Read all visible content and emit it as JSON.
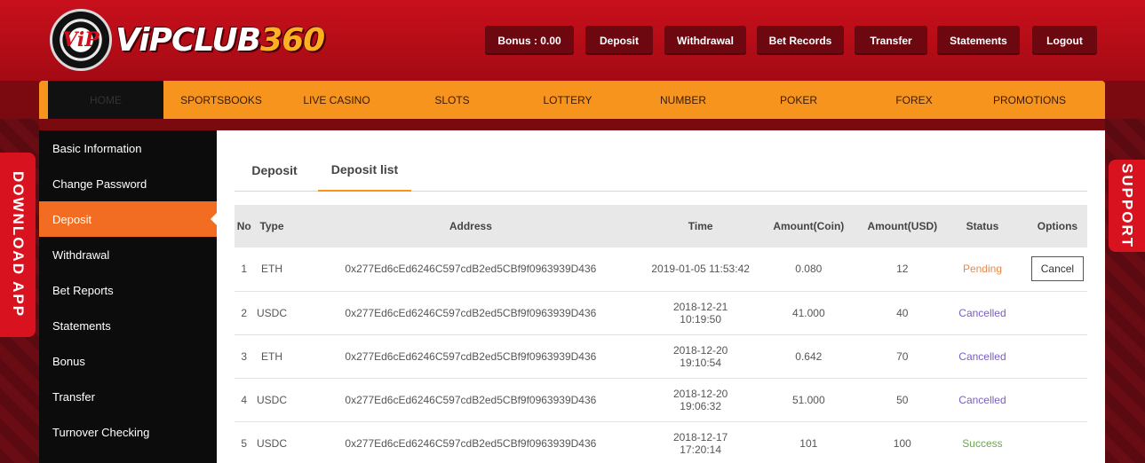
{
  "brand": {
    "logo_mark": "ViP",
    "name": "ViPCLUB",
    "name_num": "360"
  },
  "top_buttons": [
    "Bonus : 0.00",
    "Deposit",
    "Withdrawal",
    "Bet Records",
    "Transfer",
    "Statements",
    "Logout"
  ],
  "nav": [
    "HOME",
    "SPORTSBOOKS",
    "LIVE CASINO",
    "SLOTS",
    "LOTTERY",
    "NUMBER",
    "POKER",
    "FOREX",
    "PROMOTIONS"
  ],
  "side_tabs": {
    "download": "DOWNLOAD APP",
    "support": "SUPPORT"
  },
  "sidebar": [
    "Basic Information",
    "Change Password",
    "Deposit",
    "Withdrawal",
    "Bet Reports",
    "Statements",
    "Bonus",
    "Transfer",
    "Turnover Checking"
  ],
  "tabs": [
    "Deposit",
    "Deposit list"
  ],
  "table": {
    "headers": [
      "No",
      "Type",
      "Address",
      "Time",
      "Amount(Coin)",
      "Amount(USD)",
      "Status",
      "Options"
    ],
    "rows": [
      [
        "1",
        "ETH",
        "0x277Ed6cEd6246C597cdB2ed5CBf9f0963939D436",
        "2019-01-05 11:53:42",
        "0.080",
        "12",
        "Pending",
        "Cancel"
      ],
      [
        "2",
        "USDC",
        "0x277Ed6cEd6246C597cdB2ed5CBf9f0963939D436",
        "2018-12-21 10:19:50",
        "41.000",
        "40",
        "Cancelled",
        ""
      ],
      [
        "3",
        "ETH",
        "0x277Ed6cEd6246C597cdB2ed5CBf9f0963939D436",
        "2018-12-20 19:10:54",
        "0.642",
        "70",
        "Cancelled",
        ""
      ],
      [
        "4",
        "USDC",
        "0x277Ed6cEd6246C597cdB2ed5CBf9f0963939D436",
        "2018-12-20 19:06:32",
        "51.000",
        "50",
        "Cancelled",
        ""
      ],
      [
        "5",
        "USDC",
        "0x277Ed6cEd6246C597cdB2ed5CBf9f0963939D436",
        "2018-12-17 17:20:14",
        "101",
        "100",
        "Success",
        ""
      ]
    ]
  },
  "colors": {
    "brand_red": "#c8101c",
    "nav_orange": "#f7941d",
    "active_orange": "#f26d21",
    "pending": "#e8884a",
    "cancelled": "#7a5cc8",
    "success": "#6aa84f"
  }
}
